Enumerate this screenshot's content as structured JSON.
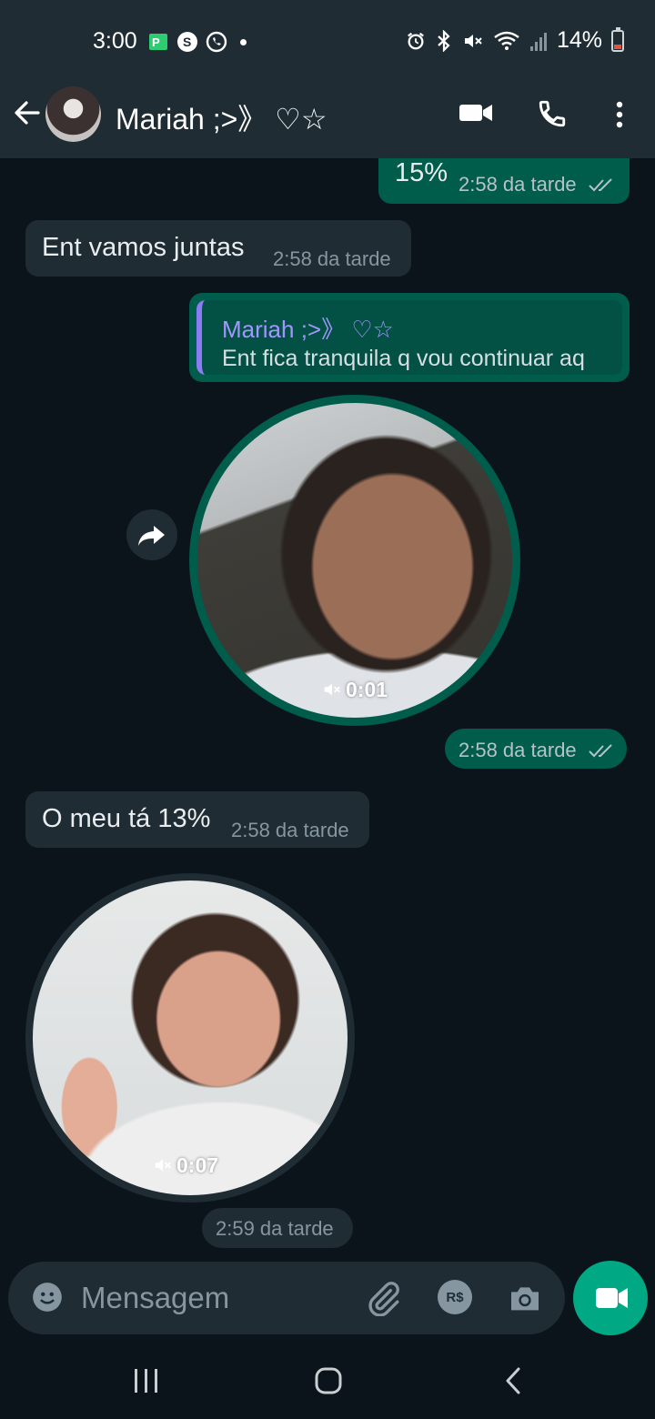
{
  "status_bar": {
    "time": "3:00",
    "battery": "14%",
    "left_icons": [
      "money-app-icon",
      "skype-icon",
      "whatsapp-icon",
      "dot-icon"
    ],
    "right_icons": [
      "alarm-icon",
      "bluetooth-icon",
      "mute-icon",
      "wifi-icon",
      "signal-icon",
      "battery-icon"
    ]
  },
  "header": {
    "contact_name": "Mariah ;>》 ♡☆",
    "icons": [
      "back-arrow-icon",
      "video-call-icon",
      "voice-call-icon",
      "more-vert-icon"
    ]
  },
  "messages": [
    {
      "direction": "out",
      "text": "15%",
      "time": "2:58 da tarde",
      "read": true
    },
    {
      "direction": "in",
      "text": "Ent vamos juntas",
      "time": "2:58 da tarde"
    },
    {
      "direction": "out",
      "type": "quote",
      "quote_name": "Mariah ;>》 ♡☆",
      "quote_text": "Ent fica tranquila q vou continuar aq"
    },
    {
      "direction": "out",
      "type": "video_note",
      "duration": "0:01",
      "time": "2:58 da tarde",
      "read": true
    },
    {
      "direction": "in",
      "text": "O meu tá 13%",
      "time": "2:58 da tarde"
    },
    {
      "direction": "in",
      "type": "video_note",
      "duration": "0:07",
      "time": "2:59 da tarde"
    }
  ],
  "input": {
    "placeholder": "Mensagem",
    "pay_label": "R$"
  },
  "colors": {
    "background": "#0b141a",
    "header": "#1f2c34",
    "outgoing_bubble": "#005c4b",
    "incoming_bubble": "#1f2c34",
    "accent": "#00a884",
    "quote_name": "#a395ff"
  }
}
